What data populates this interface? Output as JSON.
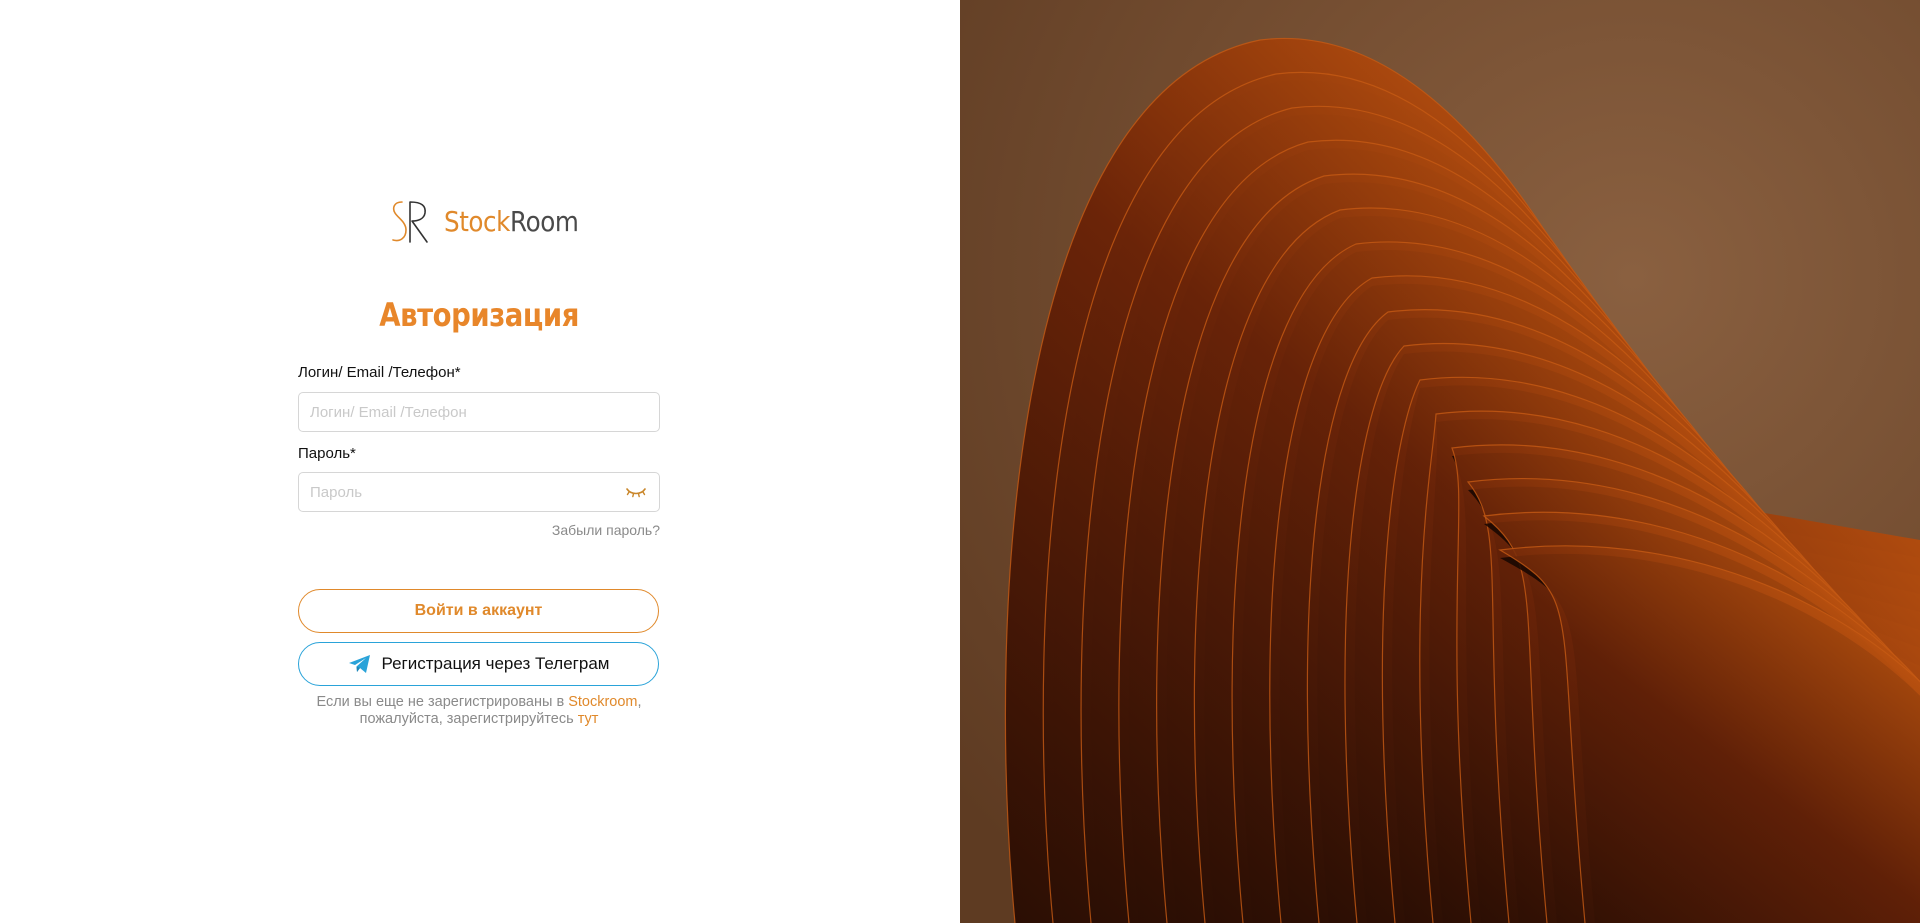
{
  "brand": {
    "monogram": "SR",
    "name_part1": "Stock",
    "name_part2": "Room"
  },
  "auth": {
    "title": "Авторизация",
    "login_label": "Логин/ Email /Телефон*",
    "login_placeholder": "Логин/ Email /Телефон",
    "login_value": "",
    "password_label": "Пароль*",
    "password_placeholder": "Пароль",
    "password_value": "",
    "password_toggle_icon": "eye-closed-icon",
    "forgot_link": "Забыли пароль?",
    "login_button": "Войти в аккаунт",
    "telegram_button": "Регистрация через Телеграм",
    "telegram_icon": "telegram-icon",
    "note_line1_prefix": "Если вы еще не зарегистрированы в ",
    "note_brand_link": "Stockroom",
    "note_line1_suffix": ",",
    "note_line2_prefix": "пожалуйста, зарегистрируйтесь ",
    "note_here_link": "тут"
  },
  "colors": {
    "accent": "#e0892b",
    "telegram": "#2aa3d9",
    "muted": "#8a8a8a",
    "hero_background": "#7a5237"
  }
}
